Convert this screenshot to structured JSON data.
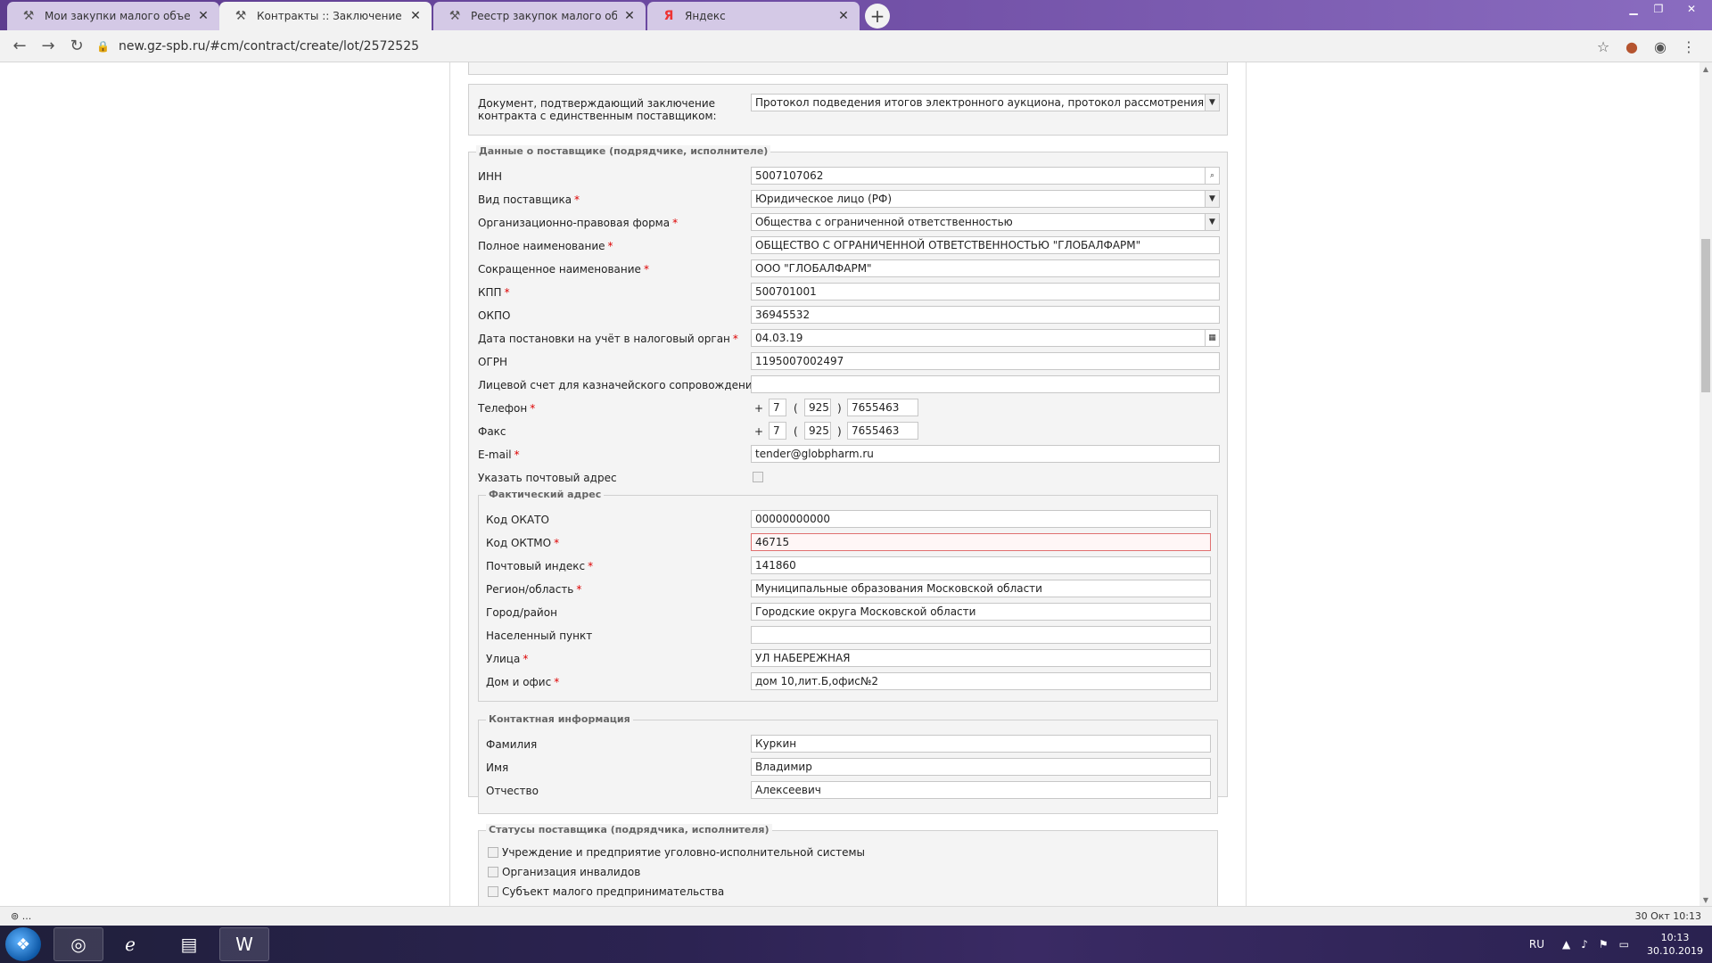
{
  "browser": {
    "tabs": [
      {
        "title": "Мои закупки малого объема | \"",
        "icon": "hammer-icon",
        "active": false
      },
      {
        "title": "Контракты :: Заключение догов",
        "icon": "hammer-icon",
        "active": true
      },
      {
        "title": "Реестр закупок малого объема",
        "icon": "hammer-icon",
        "active": false
      },
      {
        "title": "Яндекс",
        "icon": "yandex-icon",
        "active": false
      }
    ],
    "url": "new.gz-spb.ru/#cm/contract/create/lot/2572525"
  },
  "form": {
    "doc_section": {
      "label": "Документ, подтверждающий заключение контракта с единственным поставщиком:",
      "value": "Протокол подведения итогов электронного аукциона, протокол рассмотрения единственн"
    },
    "supplier": {
      "legend": "Данные о поставщике (подрядчике, исполнителе)",
      "rows": [
        {
          "label": "ИНН",
          "required": false,
          "value": "5007107062"
        },
        {
          "label": "Вид поставщика",
          "required": true,
          "value": "Юридическое лицо (РФ)"
        },
        {
          "label": "Организационно-правовая форма",
          "required": true,
          "value": "Общества с ограниченной ответственностью"
        },
        {
          "label": "Полное наименование",
          "required": true,
          "value": "ОБЩЕСТВО С ОГРАНИЧЕННОЙ ОТВЕТСТВЕННОСТЬЮ \"ГЛОБАЛФАРМ\""
        },
        {
          "label": "Сокращенное наименование",
          "required": true,
          "value": "ООО \"ГЛОБАЛФАРМ\""
        },
        {
          "label": "КПП",
          "required": true,
          "value": "500701001"
        },
        {
          "label": "ОКПО",
          "required": false,
          "value": "36945532"
        },
        {
          "label": "Дата постановки на учёт в налоговый орган",
          "required": true,
          "value": "04.03.19"
        },
        {
          "label": "ОГРН",
          "required": false,
          "value": "1195007002497"
        },
        {
          "label": "Лицевой счет для казначейского сопровождения",
          "required": false,
          "value": ""
        }
      ],
      "phone": {
        "label": "Телефон",
        "required": true,
        "plus": "+",
        "code": "7",
        "open": "(",
        "area": "925",
        "close": ")",
        "number": "7655463"
      },
      "fax": {
        "label": "Факс",
        "required": false,
        "plus": "+",
        "code": "7",
        "open": "(",
        "area": "925",
        "close": ")",
        "number": "7655463"
      },
      "email": {
        "label": "E-mail",
        "required": true,
        "value": "tender@globpharm.ru"
      },
      "postal_toggle": {
        "label": "Указать почтовый адрес"
      }
    },
    "address": {
      "legend": "Фактический адрес",
      "rows": [
        {
          "label": "Код ОКАТО",
          "required": false,
          "value": "00000000000"
        },
        {
          "label": "Код ОКТМО",
          "required": true,
          "value": "46715"
        },
        {
          "label": "Почтовый индекс",
          "required": true,
          "value": "141860"
        },
        {
          "label": "Регион/область",
          "required": true,
          "value": "Муниципальные образования Московской области"
        },
        {
          "label": "Город/район",
          "required": false,
          "value": "Городские округа Московской области"
        },
        {
          "label": "Населенный пункт",
          "required": false,
          "value": ""
        },
        {
          "label": "Улица",
          "required": true,
          "value": " УЛ НАБЕРЕЖНАЯ"
        },
        {
          "label": "Дом и офис",
          "required": true,
          "value": "дом 10,лит.Б,офис№2"
        }
      ]
    },
    "contact": {
      "legend": "Контактная информация",
      "rows": [
        {
          "label": "Фамилия",
          "value": "Куркин"
        },
        {
          "label": "Имя",
          "value": "Владимир"
        },
        {
          "label": "Отчество",
          "value": "Алексеевич"
        }
      ]
    },
    "statuses": {
      "legend": "Статусы поставщика (подрядчика, исполнителя)",
      "items": [
        "Учреждение и предприятие уголовно-исполнительной системы",
        "Организация инвалидов",
        "Субъект малого предпринимательства"
      ]
    }
  },
  "statusbar": {
    "left": "⊚ ...",
    "right": "30 Окт 10:13"
  },
  "taskbar": {
    "lang": "RU",
    "time": "10:13",
    "date": "30.10.2019"
  }
}
